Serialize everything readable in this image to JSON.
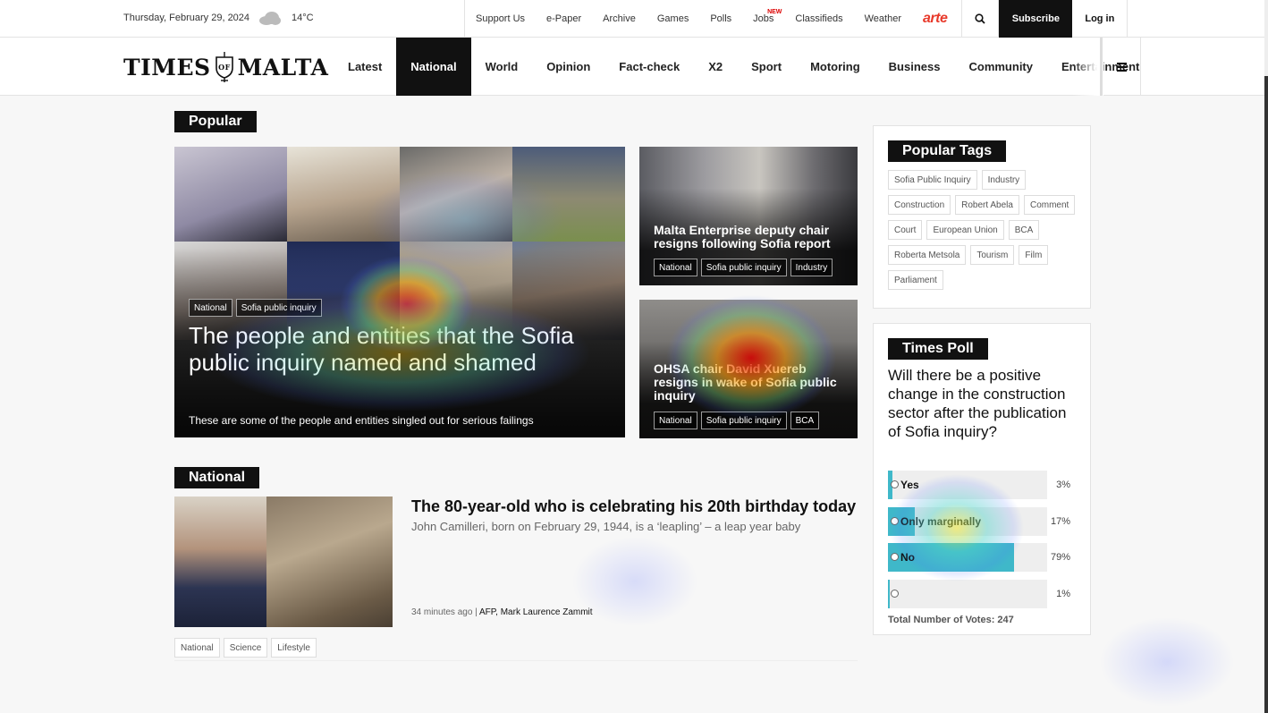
{
  "topbar": {
    "date": "Thursday, February 29, 2024",
    "temperature": "14°C",
    "weather_icon": "cloud-icon",
    "links": [
      "Support Us",
      "e-Paper",
      "Archive",
      "Games",
      "Polls",
      "Jobs",
      "Classifieds",
      "Weather"
    ],
    "jobs_badge": "NEW",
    "partner_logo": "arte",
    "subscribe_label": "Subscribe",
    "login_label": "Log in"
  },
  "nav": {
    "logo_left": "TIMES",
    "logo_crest": "OF",
    "logo_right": "MALTA",
    "items": [
      "Latest",
      "National",
      "World",
      "Opinion",
      "Fact-check",
      "X2",
      "Sport",
      "Motoring",
      "Business",
      "Community",
      "Entertainment"
    ],
    "active": "National",
    "menu_icon": "hamburger-icon"
  },
  "popular": {
    "label": "Popular",
    "hero": {
      "tags": [
        "National",
        "Sofia public inquiry"
      ],
      "headline": "The people and entities that the Sofia public inquiry named and shamed",
      "dek": "These are some of the people and entities singled out for serious failings"
    },
    "cards": [
      {
        "title": "Malta Enterprise deputy chair resigns following Sofia report",
        "tags": [
          "National",
          "Sofia public inquiry",
          "Industry"
        ]
      },
      {
        "title": "OHSA chair David Xuereb resigns in wake of Sofia public inquiry",
        "tags": [
          "National",
          "Sofia public inquiry",
          "BCA"
        ]
      }
    ]
  },
  "national": {
    "label": "National",
    "title": "The 80-year-old who is celebrating his 20th birthday today",
    "dek": "John Camilleri, born on February 29, 1944, is a ‘leapling’ – a leap year baby",
    "time": "34 minutes ago",
    "separator": "|",
    "authors": "AFP, Mark Laurence Zammit",
    "tags": [
      "National",
      "Science",
      "Lifestyle"
    ]
  },
  "popular_tags": {
    "title": "Popular Tags",
    "tags": [
      "Sofia Public Inquiry",
      "Industry",
      "Construction",
      "Robert Abela",
      "Comment",
      "Court",
      "European Union",
      "BCA",
      "Roberta Metsola",
      "Tourism",
      "Film",
      "Parliament"
    ]
  },
  "poll": {
    "title": "Times Poll",
    "question": "Will there be a positive change in the construction sector after the publication of Sofia inquiry?",
    "options": [
      {
        "label": "Yes",
        "pct": "3%",
        "value": 0.03
      },
      {
        "label": "Only marginally",
        "pct": "17%",
        "value": 0.17
      },
      {
        "label": "No",
        "pct": "79%",
        "value": 0.79
      },
      {
        "label": "",
        "pct": "1%",
        "value": 0.01
      }
    ],
    "total_label": "Total Number of Votes: 247"
  },
  "colors": {
    "accent": "#111111",
    "poll_fill": "#3fb8c9",
    "arte": "#e8392a"
  }
}
